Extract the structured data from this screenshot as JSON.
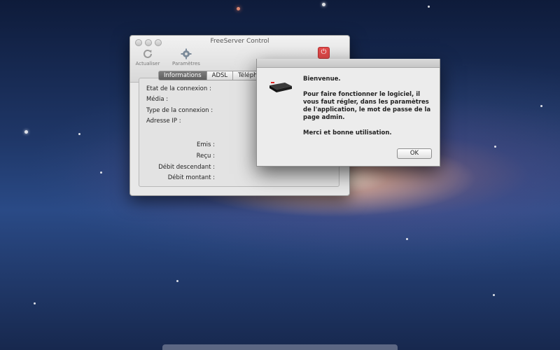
{
  "main_window": {
    "title": "FreeServer Control",
    "toolbar": {
      "refresh_label": "Actualiser",
      "settings_label": "Paramètres",
      "power_icon": "power-icon"
    },
    "tabs": [
      {
        "label": "Informations",
        "active": true
      },
      {
        "label": "ADSL",
        "active": false
      },
      {
        "label": "Téléphon",
        "active": false
      }
    ],
    "fields": {
      "connection_state": "Etat de la connexion :",
      "media": "Média :",
      "connection_type": "Type de la connexion :",
      "ip_address": "Adresse IP :",
      "sent": "Emis :",
      "received": "Reçu :",
      "download_rate": "Débit descendant :",
      "upload_rate": "Débit montant :"
    }
  },
  "dialog": {
    "welcome": "Bienvenue.",
    "message": "Pour faire fonctionner le logiciel, il vous faut régler, dans les paramètres de l'application, le mot de passe de la page admin.",
    "thanks": "Merci et bonne utilisation.",
    "ok_label": "OK",
    "icon": "router-icon"
  },
  "colors": {
    "power_button": "#e44b4b",
    "active_tab": "#6a6a6a"
  }
}
